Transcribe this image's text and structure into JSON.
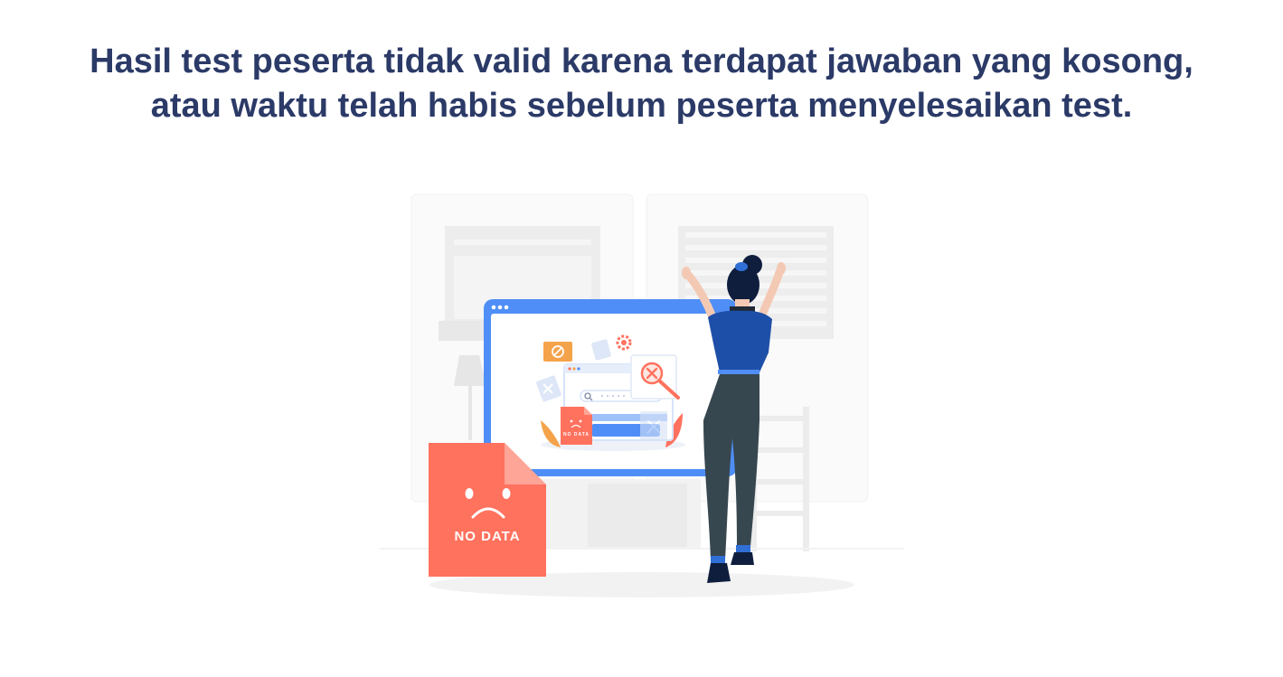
{
  "message": {
    "line1": "Hasil test peserta tidak valid karena terdapat jawaban yang kosong,",
    "line2": "atau waktu telah habis sebelum peserta menyelesaikan test."
  },
  "illustration": {
    "big_card_label": "NO DATA",
    "small_card_label": "NO DATA",
    "icons": [
      "sad-face-icon",
      "search-icon",
      "close-icon",
      "gear-icon",
      "block-icon"
    ],
    "colors": {
      "title": "#2b3a67",
      "card_red": "#ff725e",
      "monitor_blue": "#4f8ef7",
      "figure_shirt": "#1e4fa8",
      "figure_pants": "#37474f"
    }
  }
}
